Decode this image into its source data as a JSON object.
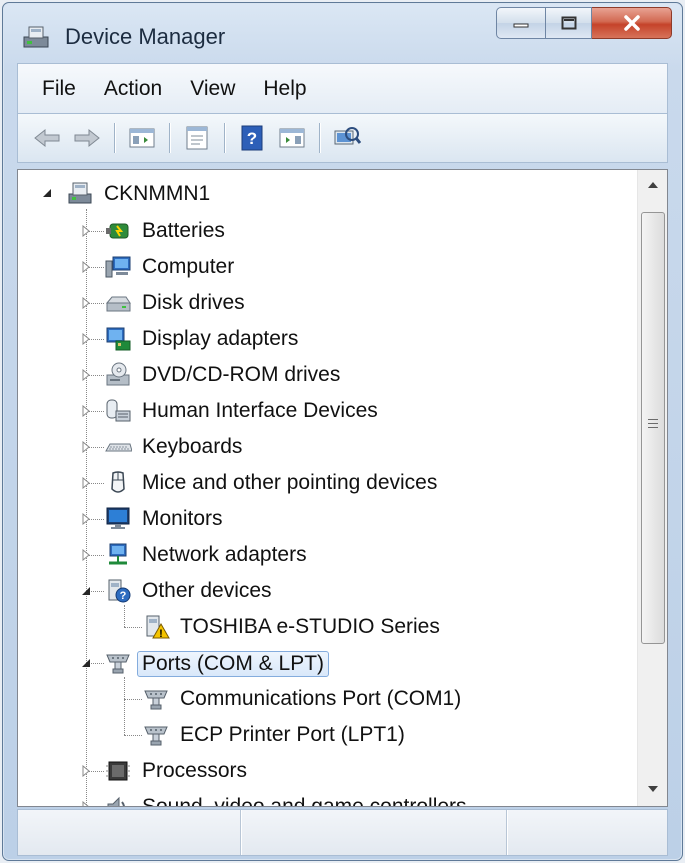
{
  "window": {
    "title": "Device Manager"
  },
  "menu": {
    "items": [
      "File",
      "Action",
      "View",
      "Help"
    ]
  },
  "toolbar": {
    "buttons": [
      "back-icon",
      "forward-icon",
      "show-hide-console-tree-icon",
      "properties-icon",
      "help-icon",
      "show-action-pane-icon",
      "scan-hardware-icon"
    ]
  },
  "tree": {
    "root": "CKNMMN1",
    "items": [
      {
        "label": "Batteries",
        "icon": "battery-icon",
        "expanded": false
      },
      {
        "label": "Computer",
        "icon": "computer-icon",
        "expanded": false
      },
      {
        "label": "Disk drives",
        "icon": "disk-drive-icon",
        "expanded": false
      },
      {
        "label": "Display adapters",
        "icon": "display-adapter-icon",
        "expanded": false
      },
      {
        "label": "DVD/CD-ROM drives",
        "icon": "dvd-drive-icon",
        "expanded": false
      },
      {
        "label": "Human Interface Devices",
        "icon": "hid-icon",
        "expanded": false
      },
      {
        "label": "Keyboards",
        "icon": "keyboard-icon",
        "expanded": false
      },
      {
        "label": "Mice and other pointing devices",
        "icon": "mouse-icon",
        "expanded": false
      },
      {
        "label": "Monitors",
        "icon": "monitor-icon",
        "expanded": false
      },
      {
        "label": "Network adapters",
        "icon": "network-adapter-icon",
        "expanded": false
      },
      {
        "label": "Other devices",
        "icon": "other-devices-icon",
        "expanded": true
      },
      {
        "label": "TOSHIBA e-STUDIO Series",
        "icon": "warning-device-icon",
        "child": true
      },
      {
        "label": "Ports (COM & LPT)",
        "icon": "port-icon",
        "expanded": true,
        "selected": true
      },
      {
        "label": "Communications Port (COM1)",
        "icon": "port-icon",
        "child": true
      },
      {
        "label": "ECP Printer Port (LPT1)",
        "icon": "port-icon",
        "child": true
      },
      {
        "label": "Processors",
        "icon": "processor-icon",
        "expanded": false
      },
      {
        "label": "Sound, video and game controllers",
        "icon": "sound-icon",
        "expanded": false
      }
    ]
  },
  "colors": {
    "selection": "#d9e8fa",
    "close_button": "#c5432a"
  }
}
